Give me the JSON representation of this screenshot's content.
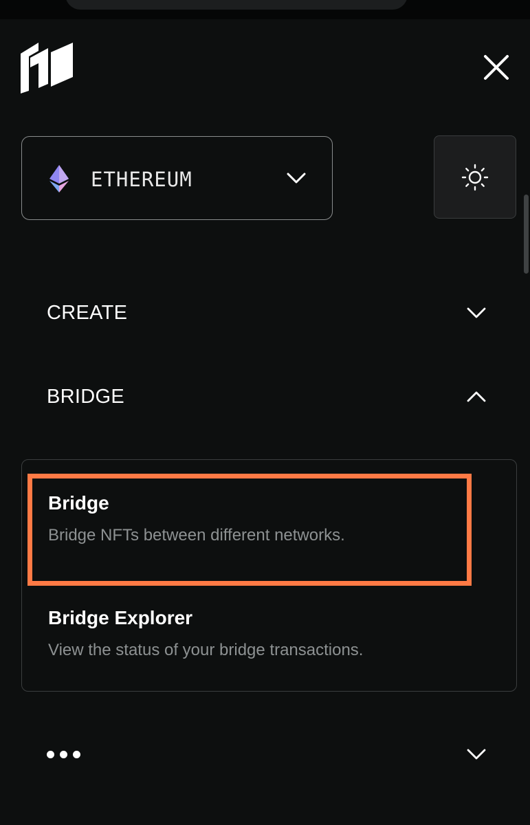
{
  "colors": {
    "background": "#0d0f0f",
    "highlight": "#ff7a45",
    "muted_text": "#8d9192",
    "border": "#3b3e3f"
  },
  "header": {
    "logo_icon": "brand-logo-icon",
    "close_icon": "close-icon"
  },
  "network_select": {
    "icon": "ethereum-icon",
    "selected": "ETHEREUM",
    "chevron_icon": "chevron-down-icon"
  },
  "theme_toggle": {
    "icon": "sun-icon"
  },
  "menu": {
    "sections": [
      {
        "label": "CREATE",
        "state": "collapsed",
        "chevron_icon": "chevron-down-icon"
      },
      {
        "label": "BRIDGE",
        "state": "expanded",
        "chevron_icon": "chevron-up-icon"
      }
    ],
    "bridge_items": [
      {
        "title": "Bridge",
        "description": "Bridge NFTs between different networks."
      },
      {
        "title": "Bridge Explorer",
        "description": "View the status of your bridge transactions."
      }
    ],
    "more": {
      "icon": "more-dots-icon",
      "chevron_icon": "chevron-down-icon"
    }
  }
}
